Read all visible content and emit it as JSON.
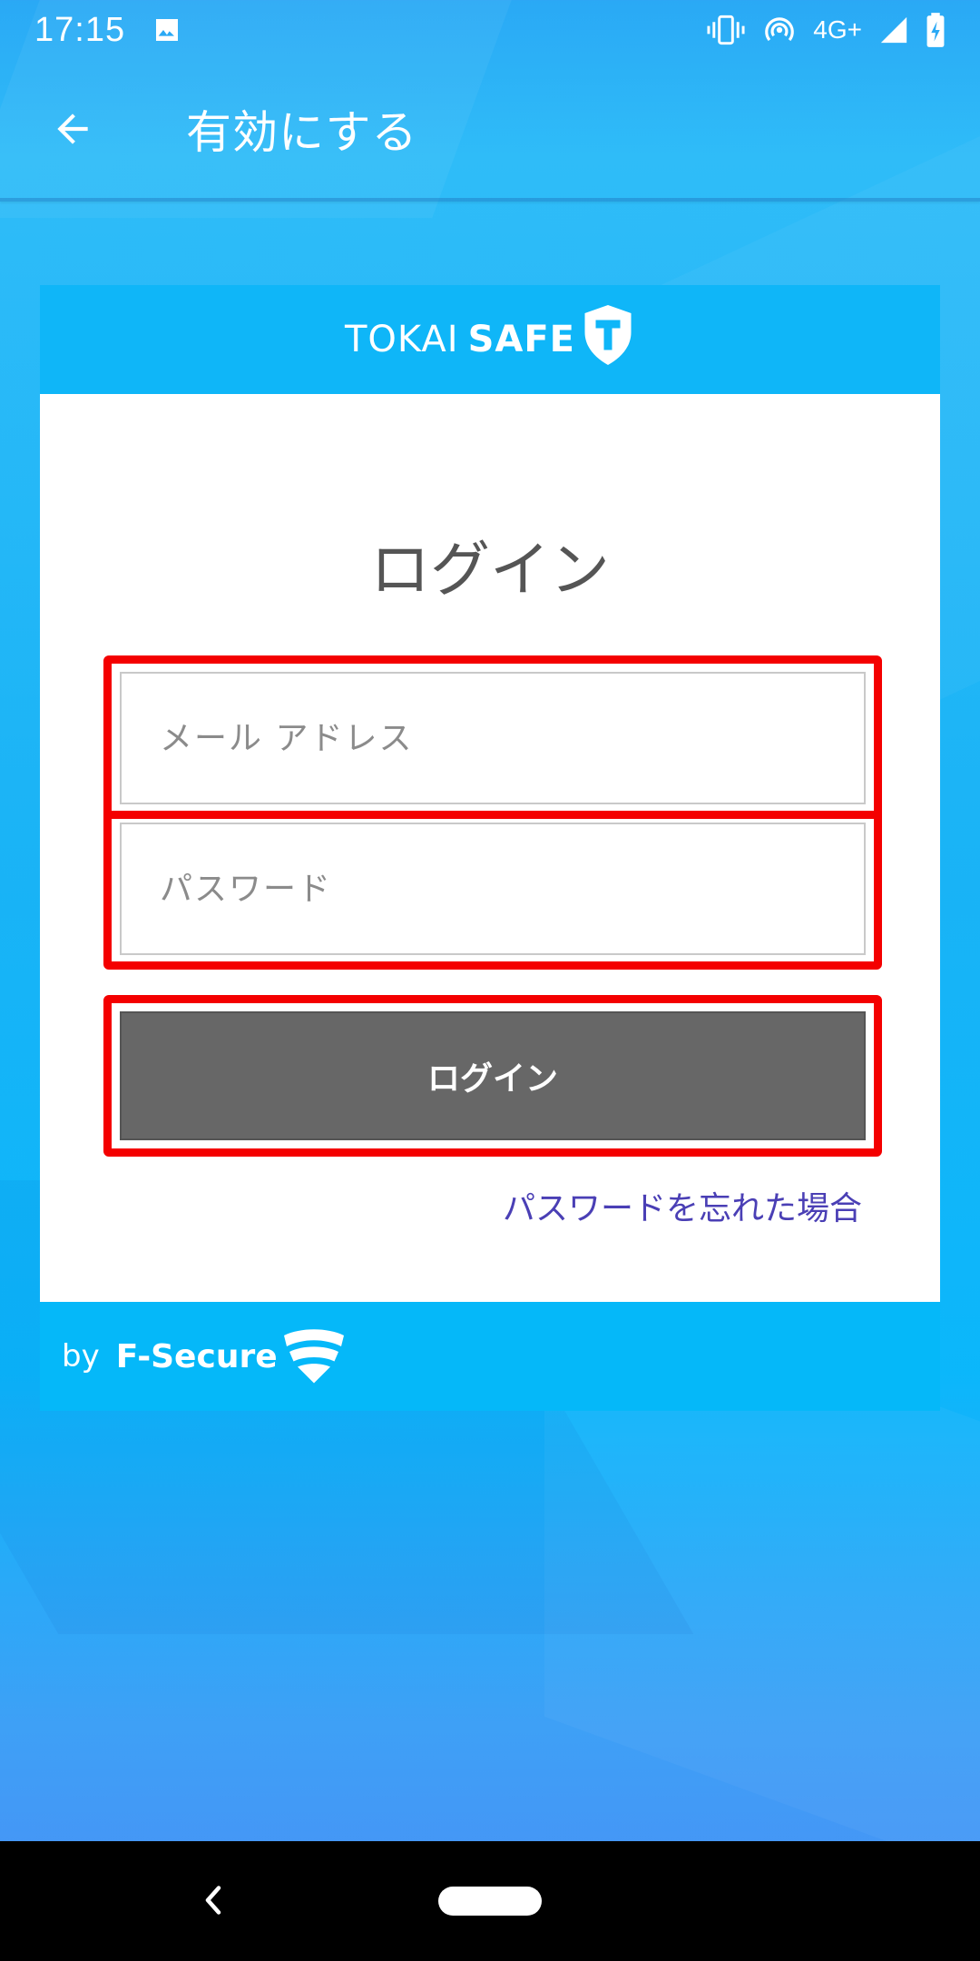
{
  "status_bar": {
    "time": "17:15",
    "network": "4G+"
  },
  "app_bar": {
    "title": "有効にする"
  },
  "card": {
    "brand_light": "TOKAI",
    "brand_bold": "SAFE",
    "login_title": "ログイン",
    "email_placeholder": "メール アドレス",
    "password_placeholder": "パスワード",
    "login_button": "ログイン",
    "forgot_password": "パスワードを忘れた場合",
    "footer_by": "by",
    "footer_brand": "F-Secure"
  },
  "colors": {
    "highlight": "#f40000",
    "button": "#676767",
    "link": "#4a3fb5"
  }
}
